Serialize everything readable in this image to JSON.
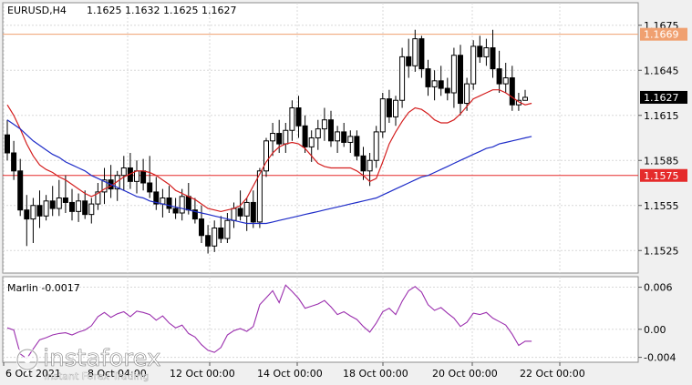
{
  "header": {
    "title": "EURUSD,H4",
    "ohlc": "1.1625 1.1632 1.1625 1.1627"
  },
  "indicator_label": "Marlin -0.0017",
  "watermark": {
    "brand": "instaforex",
    "tagline": "Instant Forex Trading"
  },
  "colors": {
    "background": "#ffffff",
    "frame": "#f0f0f0",
    "grid": "#d8d8d8",
    "candle_bull": "#ffffff",
    "candle_bear": "#000000",
    "ma_fast": "#d41e1e",
    "ma_slow": "#1e2cc8",
    "level_line": "#e52b2b",
    "top_level_line": "#f0a070",
    "marlin": "#9b2fae"
  },
  "chart_data": [
    {
      "type": "candlestick",
      "symbol": "EURUSD",
      "timeframe": "H4",
      "ylim": [
        1.151,
        1.169
      ],
      "y_ticks": [
        "1.1675",
        "1.1645",
        "1.1615",
        "1.1585",
        "1.1555",
        "1.1525"
      ],
      "x_ticks": [
        "6 Oct 2021",
        "8 Oct 04:00",
        "12 Oct 00:00",
        "14 Oct 00:00",
        "18 Oct 00:00",
        "20 Oct 00:00",
        "22 Oct 00:00"
      ],
      "price_labels": [
        {
          "value": 1.1669,
          "text": "1.1669",
          "color": "#f0a070"
        },
        {
          "value": 1.1627,
          "text": "1.1627",
          "color": "#000000"
        },
        {
          "value": 1.1575,
          "text": "1.1575",
          "color": "#e52b2b"
        }
      ],
      "horizontal_levels": [
        {
          "value": 1.1669,
          "color": "#f0a070"
        },
        {
          "value": 1.1575,
          "color": "#e52b2b"
        }
      ],
      "candles": [
        [
          1.1602,
          1.1612,
          1.1585,
          1.159
        ],
        [
          1.159,
          1.1598,
          1.1572,
          1.1578
        ],
        [
          1.1578,
          1.1586,
          1.1548,
          1.1552
        ],
        [
          1.1552,
          1.1562,
          1.1528,
          1.1546
        ],
        [
          1.1546,
          1.156,
          1.153,
          1.1555
        ],
        [
          1.1555,
          1.1565,
          1.154,
          1.1548
        ],
        [
          1.1548,
          1.1562,
          1.1545,
          1.1558
        ],
        [
          1.1558,
          1.1568,
          1.1548,
          1.1553
        ],
        [
          1.1553,
          1.1572,
          1.1548,
          1.156
        ],
        [
          1.156,
          1.1575,
          1.155,
          1.1557
        ],
        [
          1.1557,
          1.1566,
          1.1545,
          1.1551
        ],
        [
          1.1551,
          1.1563,
          1.1544,
          1.1558
        ],
        [
          1.1558,
          1.1565,
          1.1546,
          1.1549
        ],
        [
          1.1549,
          1.156,
          1.1543,
          1.1556
        ],
        [
          1.1556,
          1.157,
          1.1552,
          1.1564
        ],
        [
          1.1564,
          1.158,
          1.1556,
          1.1572
        ],
        [
          1.1572,
          1.1582,
          1.156,
          1.1566
        ],
        [
          1.1566,
          1.1578,
          1.1558,
          1.1575
        ],
        [
          1.1575,
          1.1588,
          1.1565,
          1.158
        ],
        [
          1.158,
          1.159,
          1.1566,
          1.1571
        ],
        [
          1.1571,
          1.1585,
          1.1563,
          1.1578
        ],
        [
          1.1578,
          1.1586,
          1.1565,
          1.157
        ],
        [
          1.157,
          1.1588,
          1.156,
          1.1564
        ],
        [
          1.1564,
          1.1574,
          1.1552,
          1.1556
        ],
        [
          1.1556,
          1.1566,
          1.1547,
          1.156
        ],
        [
          1.156,
          1.1568,
          1.155,
          1.1553
        ],
        [
          1.1553,
          1.156,
          1.1546,
          1.155
        ],
        [
          1.155,
          1.1566,
          1.1545,
          1.1561
        ],
        [
          1.1561,
          1.157,
          1.1549,
          1.1552
        ],
        [
          1.1552,
          1.156,
          1.1543,
          1.1546
        ],
        [
          1.1546,
          1.1555,
          1.153,
          1.1535
        ],
        [
          1.1535,
          1.1542,
          1.1523,
          1.1528
        ],
        [
          1.1528,
          1.1545,
          1.1524,
          1.154
        ],
        [
          1.154,
          1.1548,
          1.153,
          1.1533
        ],
        [
          1.1533,
          1.155,
          1.153,
          1.1545
        ],
        [
          1.1545,
          1.1557,
          1.154,
          1.1553
        ],
        [
          1.1553,
          1.1565,
          1.1545,
          1.1548
        ],
        [
          1.1548,
          1.156,
          1.1538,
          1.1557
        ],
        [
          1.1557,
          1.1565,
          1.154,
          1.1544
        ],
        [
          1.1544,
          1.158,
          1.154,
          1.1578
        ],
        [
          1.1578,
          1.16,
          1.1574,
          1.1598
        ],
        [
          1.1598,
          1.161,
          1.1588,
          1.1603
        ],
        [
          1.1603,
          1.1612,
          1.159,
          1.1596
        ],
        [
          1.1596,
          1.161,
          1.159,
          1.1605
        ],
        [
          1.1605,
          1.1625,
          1.1598,
          1.162
        ],
        [
          1.162,
          1.1628,
          1.16,
          1.1608
        ],
        [
          1.1608,
          1.1615,
          1.159,
          1.1594
        ],
        [
          1.1594,
          1.1605,
          1.1584,
          1.16
        ],
        [
          1.16,
          1.1612,
          1.1592,
          1.1606
        ],
        [
          1.1606,
          1.162,
          1.1598,
          1.1612
        ],
        [
          1.1612,
          1.1618,
          1.1594,
          1.1598
        ],
        [
          1.1598,
          1.1608,
          1.159,
          1.1604
        ],
        [
          1.1604,
          1.161,
          1.1594,
          1.1597
        ],
        [
          1.1597,
          1.1605,
          1.159,
          1.1601
        ],
        [
          1.1601,
          1.1605,
          1.1585,
          1.1588
        ],
        [
          1.1588,
          1.1594,
          1.1572,
          1.1578
        ],
        [
          1.1578,
          1.159,
          1.1568,
          1.1585
        ],
        [
          1.1585,
          1.1608,
          1.158,
          1.1604
        ],
        [
          1.1604,
          1.163,
          1.16,
          1.1626
        ],
        [
          1.1626,
          1.1632,
          1.161,
          1.1614
        ],
        [
          1.1614,
          1.1628,
          1.1608,
          1.1625
        ],
        [
          1.1625,
          1.166,
          1.162,
          1.1654
        ],
        [
          1.1654,
          1.1666,
          1.164,
          1.1648
        ],
        [
          1.1648,
          1.1672,
          1.1644,
          1.1666
        ],
        [
          1.1666,
          1.1668,
          1.164,
          1.1646
        ],
        [
          1.1646,
          1.1652,
          1.1628,
          1.1634
        ],
        [
          1.1634,
          1.1645,
          1.1625,
          1.1638
        ],
        [
          1.1638,
          1.1648,
          1.1628,
          1.1633
        ],
        [
          1.1633,
          1.164,
          1.1625,
          1.163
        ],
        [
          1.163,
          1.166,
          1.162,
          1.1655
        ],
        [
          1.1655,
          1.1662,
          1.1615,
          1.1623
        ],
        [
          1.1623,
          1.164,
          1.1618,
          1.1636
        ],
        [
          1.1636,
          1.1665,
          1.1632,
          1.1661
        ],
        [
          1.1661,
          1.1668,
          1.165,
          1.1654
        ],
        [
          1.1654,
          1.1666,
          1.1648,
          1.166
        ],
        [
          1.166,
          1.1672,
          1.164,
          1.1646
        ],
        [
          1.1646,
          1.1658,
          1.163,
          1.1636
        ],
        [
          1.1636,
          1.165,
          1.163,
          1.164
        ],
        [
          1.164,
          1.1648,
          1.1618,
          1.1622
        ],
        [
          1.1622,
          1.163,
          1.1618,
          1.1625
        ],
        [
          1.1625,
          1.1632,
          1.1625,
          1.1627
        ]
      ],
      "series": [
        {
          "kind": "ma_fast",
          "color": "#d41e1e",
          "values": [
            1.1622,
            1.1615,
            1.1606,
            1.1596,
            1.1588,
            1.1582,
            1.1579,
            1.1577,
            1.1574,
            1.1572,
            1.1569,
            1.1566,
            1.1563,
            1.1561,
            1.1563,
            1.1566,
            1.1568,
            1.1571,
            1.1574,
            1.1576,
            1.1578,
            1.1578,
            1.1577,
            1.1575,
            1.1572,
            1.1569,
            1.1565,
            1.1563,
            1.1561,
            1.1559,
            1.1556,
            1.1553,
            1.1552,
            1.1551,
            1.1552,
            1.1553,
            1.1555,
            1.156,
            1.1568,
            1.1576,
            1.1584,
            1.159,
            1.1594,
            1.1596,
            1.1597,
            1.1596,
            1.1593,
            1.1588,
            1.1583,
            1.1581,
            1.158,
            1.158,
            1.158,
            1.158,
            1.1578,
            1.1575,
            1.1571,
            1.1573,
            1.1584,
            1.1596,
            1.1604,
            1.1611,
            1.1617,
            1.162,
            1.1619,
            1.1616,
            1.1612,
            1.161,
            1.161,
            1.1612,
            1.1616,
            1.1621,
            1.1626,
            1.1628,
            1.163,
            1.1632,
            1.1632,
            1.163,
            1.1627,
            1.1624,
            1.1622,
            1.1623
          ]
        },
        {
          "kind": "ma_slow",
          "color": "#1e2cc8",
          "values": [
            1.1612,
            1.1609,
            1.1606,
            1.1602,
            1.1598,
            1.1595,
            1.1592,
            1.1589,
            1.1587,
            1.1584,
            1.1582,
            1.158,
            1.1578,
            1.1575,
            1.1573,
            1.1571,
            1.1569,
            1.1567,
            1.1565,
            1.1563,
            1.1561,
            1.156,
            1.1558,
            1.1557,
            1.1556,
            1.1555,
            1.1554,
            1.1553,
            1.1552,
            1.1551,
            1.155,
            1.1549,
            1.1548,
            1.1547,
            1.1546,
            1.1545,
            1.1544,
            1.1543,
            1.1543,
            1.1543,
            1.1543,
            1.1544,
            1.1545,
            1.1546,
            1.1547,
            1.1548,
            1.1549,
            1.155,
            1.1551,
            1.1552,
            1.1553,
            1.1554,
            1.1555,
            1.1556,
            1.1557,
            1.1558,
            1.1559,
            1.156,
            1.1562,
            1.1564,
            1.1566,
            1.1568,
            1.157,
            1.1572,
            1.1574,
            1.1575,
            1.1577,
            1.1579,
            1.1581,
            1.1583,
            1.1585,
            1.1587,
            1.1589,
            1.1591,
            1.1593,
            1.1594,
            1.1596,
            1.1597,
            1.1598,
            1.1599,
            1.16,
            1.1601
          ]
        }
      ]
    },
    {
      "type": "line",
      "name": "Marlin",
      "ylim": [
        -0.0047,
        0.0075
      ],
      "y_ticks": [
        "0.006",
        "0.00",
        "-0.004"
      ],
      "series": [
        {
          "name": "Marlin",
          "color": "#9b2fae",
          "values": [
            0.0002,
            -0.0001,
            -0.0035,
            -0.0042,
            -0.0028,
            -0.0015,
            -0.0012,
            -0.0008,
            -0.0006,
            -0.0005,
            -0.0008,
            -0.0004,
            -0.0001,
            0.0005,
            0.0018,
            0.0024,
            0.0017,
            0.0022,
            0.0025,
            0.0018,
            0.0026,
            0.0024,
            0.0021,
            0.0013,
            0.0019,
            0.0009,
            0.0002,
            0.0006,
            -0.0006,
            -0.0011,
            -0.0022,
            -0.003,
            -0.0033,
            -0.0026,
            -0.0008,
            -0.0002,
            0.0001,
            -0.0003,
            0.0004,
            0.0035,
            0.0045,
            0.0055,
            0.0038,
            0.0063,
            0.0054,
            0.0044,
            0.003,
            0.0033,
            0.0036,
            0.0041,
            0.0032,
            0.0021,
            0.0025,
            0.0019,
            0.0014,
            0.0004,
            -0.0004,
            0.0009,
            0.0025,
            0.003,
            0.0021,
            0.004,
            0.0055,
            0.0061,
            0.0053,
            0.0035,
            0.0027,
            0.0031,
            0.0023,
            0.0016,
            0.0004,
            0.001,
            0.0023,
            0.0021,
            0.0024,
            0.0016,
            0.0011,
            0.0006,
            -0.0007,
            -0.0023,
            -0.0017,
            -0.0017
          ]
        }
      ]
    }
  ]
}
